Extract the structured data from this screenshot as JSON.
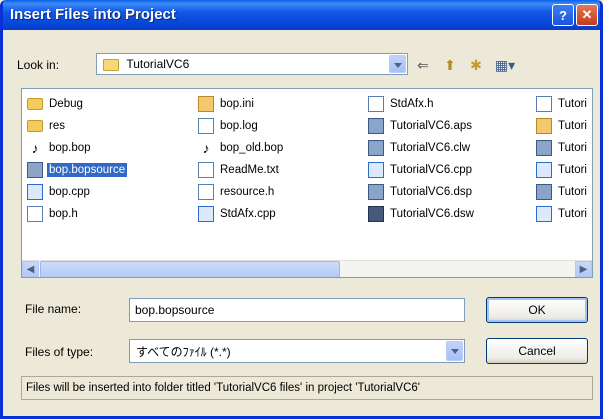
{
  "window": {
    "title": "Insert Files into Project",
    "help_glyph": "?",
    "close_glyph": "✕"
  },
  "look_in": {
    "label": "Look in:",
    "value": "TutorialVC6"
  },
  "toolbar": {
    "back_glyph": "⇐",
    "up_glyph": "⬆",
    "new_folder_glyph": "✱",
    "views_glyph": "▦▾"
  },
  "files": {
    "col1": [
      {
        "name": "Debug",
        "icon": "folder-icon"
      },
      {
        "name": "res",
        "icon": "folder-icon"
      },
      {
        "name": "bop.bop",
        "icon": "note-icon"
      },
      {
        "name": "bop.bopsource",
        "icon": "grid-icon",
        "selected": true
      },
      {
        "name": "bop.cpp",
        "icon": "cpp-icon"
      },
      {
        "name": "bop.h",
        "icon": "doc-icon"
      }
    ],
    "col2": [
      {
        "name": "bop.ini",
        "icon": "ini-icon"
      },
      {
        "name": "bop.log",
        "icon": "doc-icon"
      },
      {
        "name": "bop_old.bop",
        "icon": "note-icon"
      },
      {
        "name": "ReadMe.txt",
        "icon": "doc-icon"
      },
      {
        "name": "resource.h",
        "icon": "doc-icon"
      },
      {
        "name": "StdAfx.cpp",
        "icon": "cpp-icon"
      }
    ],
    "col3": [
      {
        "name": "StdAfx.h",
        "icon": "doc-icon"
      },
      {
        "name": "TutorialVC6.aps",
        "icon": "grid-icon"
      },
      {
        "name": "TutorialVC6.clw",
        "icon": "grid-icon"
      },
      {
        "name": "TutorialVC6.cpp",
        "icon": "cpp-icon"
      },
      {
        "name": "TutorialVC6.dsp",
        "icon": "grid-icon"
      },
      {
        "name": "TutorialVC6.dsw",
        "icon": "sln-icon"
      }
    ],
    "col4": [
      {
        "name": "Tutori",
        "icon": "doc-icon"
      },
      {
        "name": "Tutori",
        "icon": "ini-icon"
      },
      {
        "name": "Tutori",
        "icon": "grid-icon"
      },
      {
        "name": "Tutori",
        "icon": "cpp-icon"
      },
      {
        "name": "Tutori",
        "icon": "grid-icon"
      },
      {
        "name": "Tutori",
        "icon": "cpp-icon"
      }
    ]
  },
  "scroll": {
    "left_glyph": "◀",
    "right_glyph": "▶"
  },
  "file_name": {
    "label": "File name:",
    "value": "bop.bopsource"
  },
  "file_type": {
    "label": "Files of type:",
    "value": "すべてのﾌｧｲﾙ (*.*)"
  },
  "buttons": {
    "ok": "OK",
    "cancel": "Cancel"
  },
  "status": "Files will be inserted into folder titled 'TutorialVC6 files' in project 'TutorialVC6'"
}
